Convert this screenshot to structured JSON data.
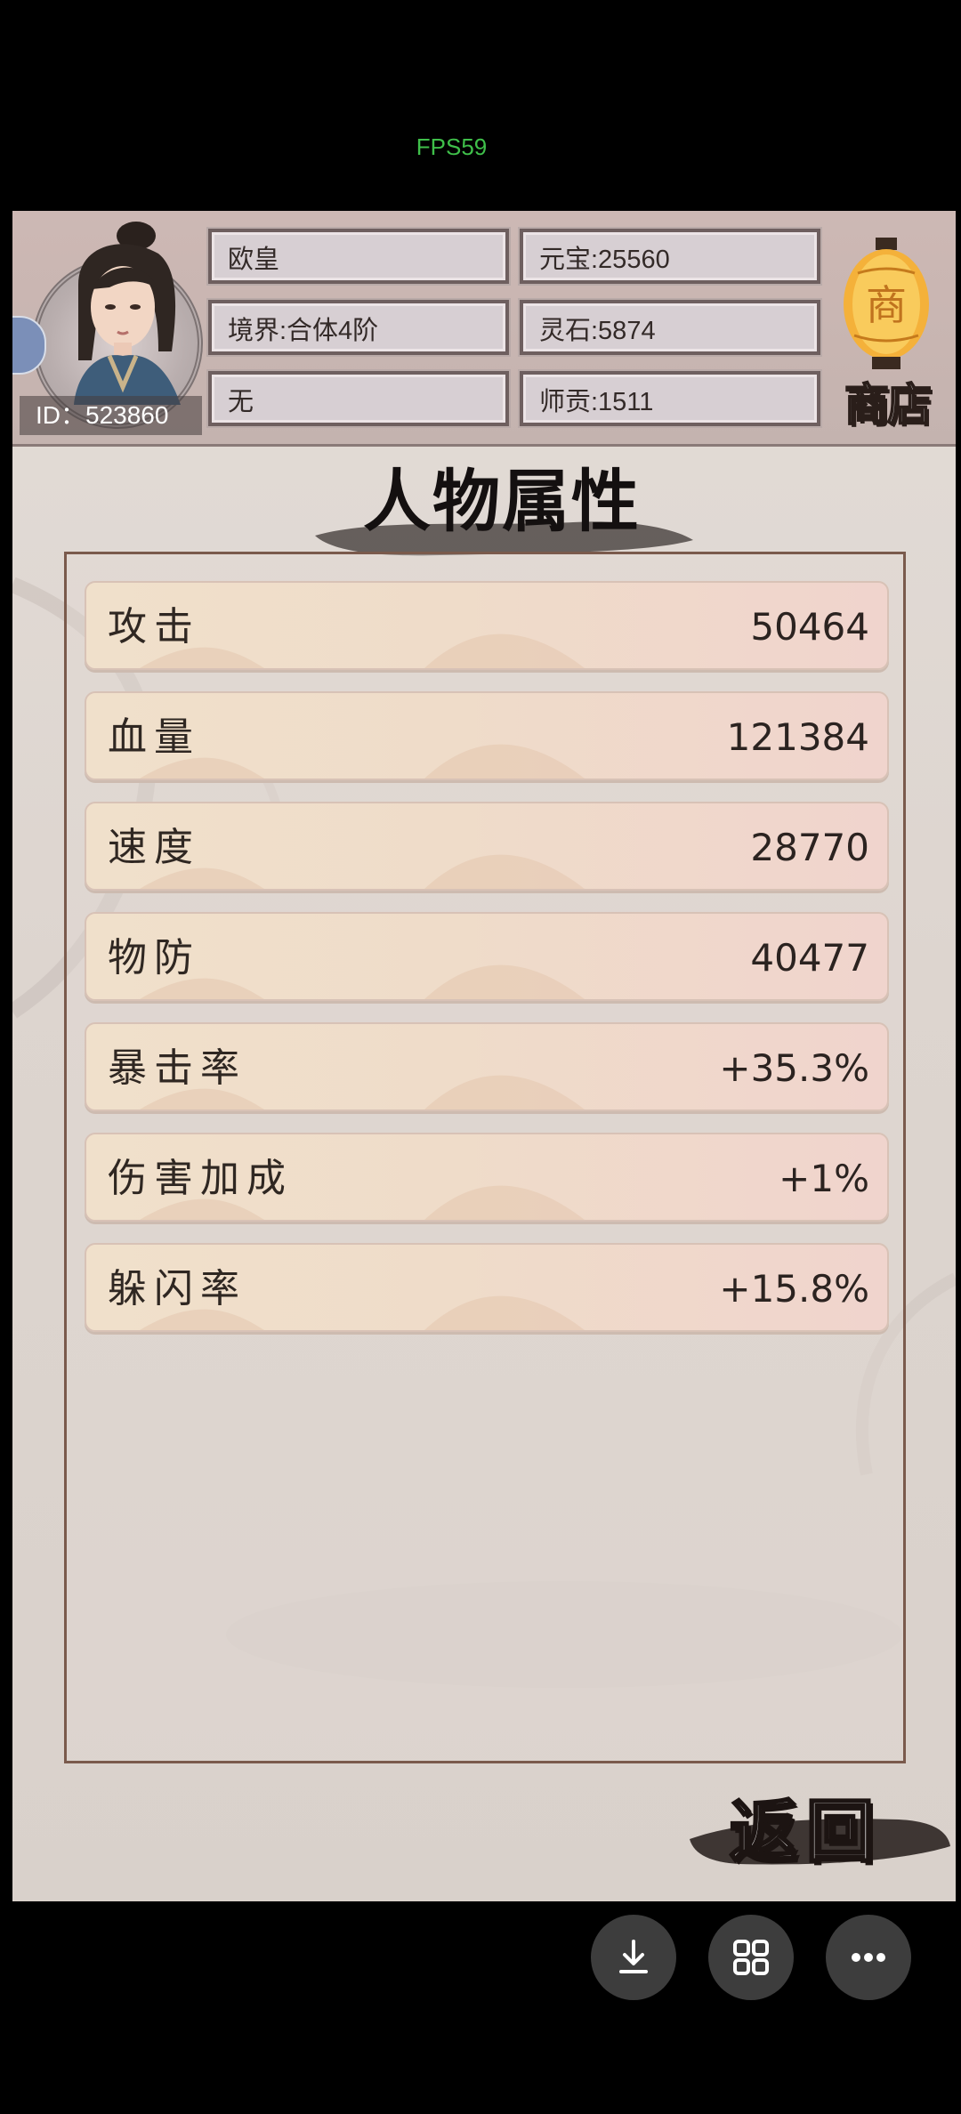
{
  "overlay": {
    "fps": "FPS59"
  },
  "player": {
    "id_label": "ID：523860",
    "name": "欧皇",
    "realm": "境界:合体4阶",
    "title": "无",
    "yuanbao": "元宝:25560",
    "lingshi": "灵石:5874",
    "shigong": "师贡:1511"
  },
  "shop": {
    "label": "商店",
    "lantern_char": "商"
  },
  "page": {
    "title": "人物属性"
  },
  "stats": [
    {
      "label": "攻击",
      "value": "50464"
    },
    {
      "label": "血量",
      "value": "121384"
    },
    {
      "label": "速度",
      "value": "28770"
    },
    {
      "label": "物防",
      "value": "40477"
    },
    {
      "label": "暴击率",
      "value": "+35.3%"
    },
    {
      "label": "伤害加成",
      "value": "+1%"
    },
    {
      "label": "躲闪率",
      "value": "+15.8%"
    }
  ],
  "footer": {
    "back_label": "返回"
  },
  "colors": {
    "panel_border": "#7a5a4c",
    "header_bg": "#cdb8b4",
    "fps_green": "#3fbf4a"
  }
}
